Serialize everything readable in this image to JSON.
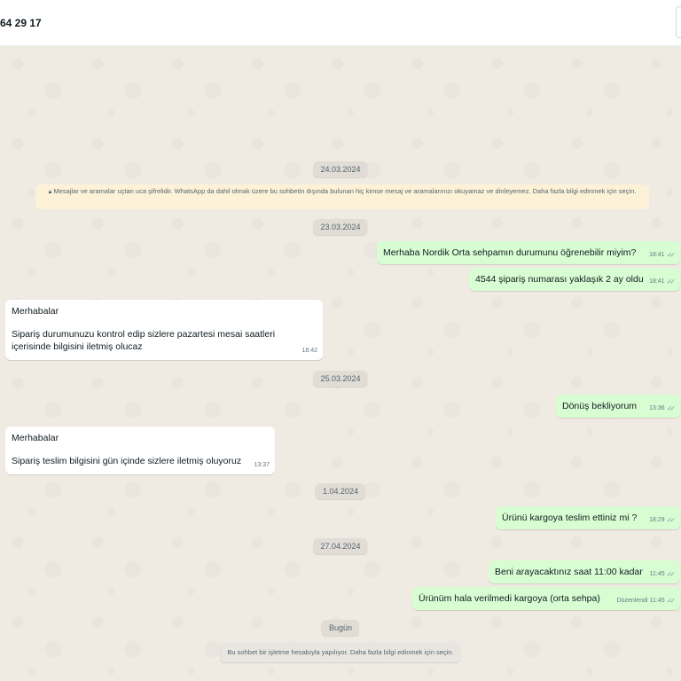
{
  "header": {
    "title": "64 29 17"
  },
  "dates": {
    "d1": "24.03.2024",
    "d2": "23.03.2024",
    "d3": "25.03.2024",
    "d4": "1.04.2024",
    "d5": "27.04.2024",
    "d6": "Bugün"
  },
  "notice": {
    "lock_icon": "lock-icon",
    "text": "Mesajlar ve aramalar uçtan uca şifrelidir. WhatsApp da dahil olmak üzere bu sohbetin dışında bulunan hiç kimse mesaj ve aramalarınızı okuyamaz ve dinleyemez. Daha fazla bilgi edinmek için seçin."
  },
  "messages": [
    {
      "text": "Merhaba Nordik Orta sehpamın durumunu öğrenebilir miyim?",
      "time": "18:41"
    },
    {
      "text": "4544 şipariş numarası yaklaşık 2 ay oldu",
      "time": "18:41"
    },
    {
      "line1": "Merhabalar",
      "line2": "Sipariş durumunuzu kontrol edip sizlere pazartesi mesai saatleri içerisinde bilgisini iletmiş olucaz",
      "time": "18:42"
    },
    {
      "text": "Dönüş bekliyorum",
      "time": "13:36"
    },
    {
      "line1": "Merhabalar",
      "line2": "Sipariş teslim bilgisini gün içinde sizlere iletmiş oluyoruz",
      "time": "13:37"
    },
    {
      "text": "Ürünü kargoya teslim ettiniz mi ?",
      "time": "18:29"
    },
    {
      "text": "Beni arayacaktınız saat 11:00 kadar",
      "time": "11:45"
    },
    {
      "text": "Ürünüm hala verilmedi kargoya (orta sehpa)",
      "edited": "Düzenlendi",
      "time": "11:45"
    }
  ],
  "footer": {
    "text": "Bu sohbet bir işletme hesabıyla yapılıyor. Daha fazla bilgi edinmek için seçin."
  }
}
